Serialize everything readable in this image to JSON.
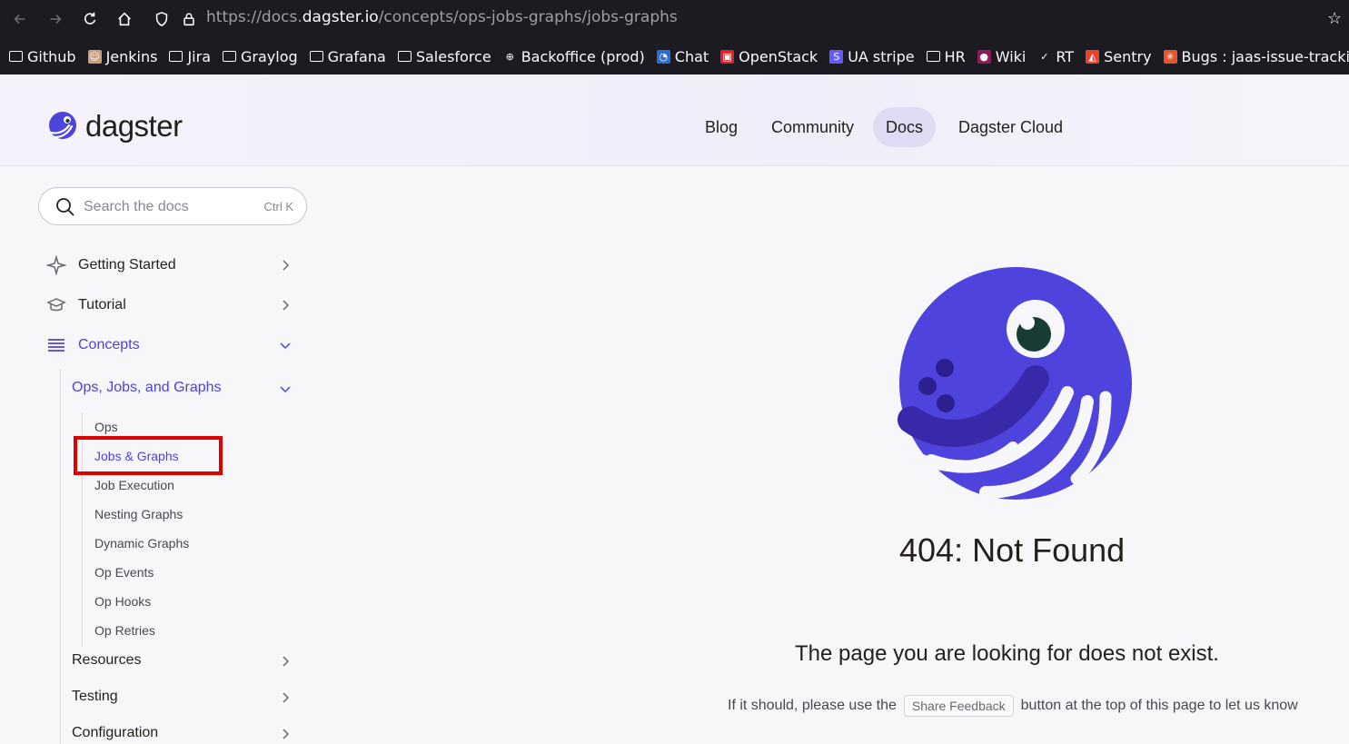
{
  "browser": {
    "url_prefix": "https://docs.",
    "url_host": "dagster.io",
    "url_path": "/concepts/ops-jobs-graphs/jobs-graphs"
  },
  "bookmarks": [
    {
      "label": "Github",
      "icon": "folder-icon"
    },
    {
      "label": "Jenkins",
      "icon": "jenkins-icon"
    },
    {
      "label": "Jira",
      "icon": "folder-icon"
    },
    {
      "label": "Graylog",
      "icon": "folder-icon"
    },
    {
      "label": "Grafana",
      "icon": "folder-icon"
    },
    {
      "label": "Salesforce",
      "icon": "folder-icon"
    },
    {
      "label": "Backoffice (prod)",
      "icon": "globe-icon"
    },
    {
      "label": "Chat",
      "icon": "chat-icon"
    },
    {
      "label": "OpenStack",
      "icon": "openstack-icon"
    },
    {
      "label": "UA stripe",
      "icon": "stripe-icon"
    },
    {
      "label": "HR",
      "icon": "folder-icon"
    },
    {
      "label": "Wiki",
      "icon": "wiki-icon"
    },
    {
      "label": "RT",
      "icon": "rt-icon"
    },
    {
      "label": "Sentry",
      "icon": "sentry-icon"
    },
    {
      "label": "Bugs : jaas-issue-tracking",
      "icon": "bugs-icon"
    }
  ],
  "header": {
    "logo_text": "dagster",
    "nav": [
      "Blog",
      "Community",
      "Docs",
      "Dagster Cloud"
    ],
    "active_nav": "Docs"
  },
  "sidebar": {
    "search_placeholder": "Search the docs",
    "search_shortcut": "Ctrl K",
    "sections": {
      "getting_started": "Getting Started",
      "tutorial": "Tutorial",
      "concepts": "Concepts",
      "ops_jobs_graphs": "Ops, Jobs, and Graphs",
      "resources": "Resources",
      "testing": "Testing",
      "configuration": "Configuration"
    },
    "sub_items": [
      "Ops",
      "Jobs & Graphs",
      "Job Execution",
      "Nesting Graphs",
      "Dynamic Graphs",
      "Op Events",
      "Op Hooks",
      "Op Retries"
    ],
    "active_sub_item": "Jobs & Graphs"
  },
  "main": {
    "error_title": "404: Not Found",
    "error_message": "The page you are looking for does not exist.",
    "hint_before": "If it should, please use the",
    "feedback_button": "Share Feedback",
    "hint_after": "button at the top of this page to let us know"
  },
  "colors": {
    "accent": "#4f43dd",
    "mascot": "#4f43dd",
    "highlight": "#e00000"
  }
}
